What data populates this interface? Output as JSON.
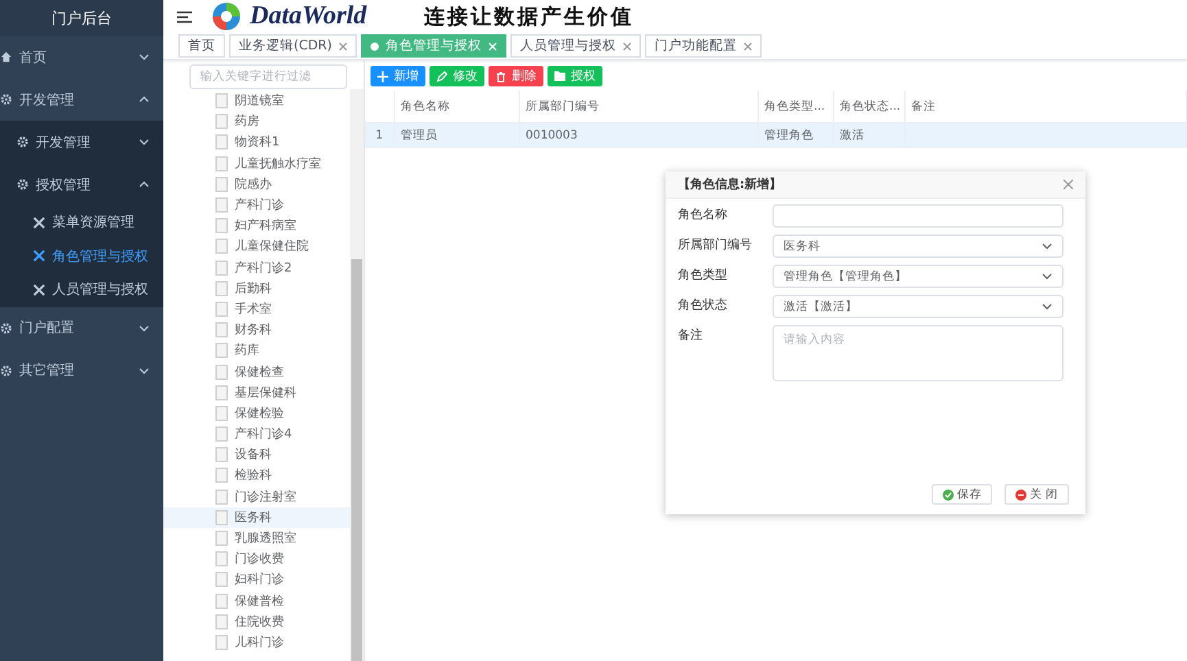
{
  "sidebar": {
    "title": "门户后台",
    "menu": [
      {
        "label": "首页",
        "kind": "home",
        "expanded": false
      },
      {
        "label": "开发管理",
        "kind": "group",
        "expanded": true,
        "children": [
          {
            "label": "开发管理",
            "kind": "group",
            "expanded": false
          },
          {
            "label": "授权管理",
            "kind": "group",
            "expanded": true,
            "children": [
              {
                "label": "菜单资源管理",
                "kind": "leaf",
                "selected": false
              },
              {
                "label": "角色管理与授权",
                "kind": "leaf",
                "selected": true
              },
              {
                "label": "人员管理与授权",
                "kind": "leaf",
                "selected": false
              }
            ]
          }
        ]
      },
      {
        "label": "门户配置",
        "kind": "group",
        "expanded": false
      },
      {
        "label": "其它管理",
        "kind": "group",
        "expanded": false
      }
    ]
  },
  "header": {
    "logo_text": "DataWorld",
    "slogan": "连接让数据产生价值"
  },
  "tabs": [
    {
      "label": "首页",
      "selected": false,
      "closable": false
    },
    {
      "label": "业务逻辑(CDR)",
      "selected": false,
      "closable": true
    },
    {
      "label": "角色管理与授权",
      "selected": true,
      "closable": true
    },
    {
      "label": "人员管理与授权",
      "selected": false,
      "closable": true
    },
    {
      "label": "门户功能配置",
      "selected": false,
      "closable": true
    }
  ],
  "tree": {
    "placeholder": "输入关键字进行过滤",
    "items": [
      {
        "label": "阴道镜室",
        "selected": false
      },
      {
        "label": "药房",
        "selected": false
      },
      {
        "label": "物资科1",
        "selected": false
      },
      {
        "label": "儿童抚触水疗室",
        "selected": false
      },
      {
        "label": "院感办",
        "selected": false
      },
      {
        "label": "产科门诊",
        "selected": false
      },
      {
        "label": "妇产科病室",
        "selected": false
      },
      {
        "label": "儿童保健住院",
        "selected": false
      },
      {
        "label": "产科门诊2",
        "selected": false
      },
      {
        "label": "后勤科",
        "selected": false
      },
      {
        "label": "手术室",
        "selected": false
      },
      {
        "label": "财务科",
        "selected": false
      },
      {
        "label": "药库",
        "selected": false
      },
      {
        "label": "保健检查",
        "selected": false
      },
      {
        "label": "基层保健科",
        "selected": false
      },
      {
        "label": "保健检验",
        "selected": false
      },
      {
        "label": "产科门诊4",
        "selected": false
      },
      {
        "label": "设备科",
        "selected": false
      },
      {
        "label": "检验科",
        "selected": false
      },
      {
        "label": "门诊注射室",
        "selected": false
      },
      {
        "label": "医务科",
        "selected": true
      },
      {
        "label": "乳腺透照室",
        "selected": false
      },
      {
        "label": "门诊收费",
        "selected": false
      },
      {
        "label": "妇科门诊",
        "selected": false
      },
      {
        "label": "保健普检",
        "selected": false
      },
      {
        "label": "住院收费",
        "selected": false
      },
      {
        "label": "儿科门诊",
        "selected": false
      }
    ]
  },
  "toolbar": [
    {
      "label": "新增",
      "kind": "add"
    },
    {
      "label": "修改",
      "kind": "edit"
    },
    {
      "label": "删除",
      "kind": "delete"
    },
    {
      "label": "授权",
      "kind": "grant"
    }
  ],
  "table": {
    "columns": [
      "角色名称",
      "所属部门编号",
      "角色类型...",
      "角色状态...",
      "备注"
    ],
    "rows": [
      {
        "index": "1",
        "cells": [
          "管理员",
          "0010003",
          "管理角色",
          "激活",
          ""
        ],
        "selected": true
      }
    ]
  },
  "dialog": {
    "title": "【角色信息:新增】",
    "fields": [
      {
        "label": "角色名称",
        "kind": "input"
      },
      {
        "label": "所属部门编号",
        "kind": "select",
        "value": "医务科"
      },
      {
        "label": "角色类型",
        "kind": "select",
        "value": "管理角色【管理角色】"
      },
      {
        "label": "角色状态",
        "kind": "select",
        "value": "激活【激活】"
      },
      {
        "label": "备注",
        "kind": "textarea",
        "placeholder": "请输入内容"
      }
    ],
    "buttons": [
      {
        "label": "保存",
        "kind": "save"
      },
      {
        "label": "关 闭",
        "kind": "close"
      }
    ]
  }
}
